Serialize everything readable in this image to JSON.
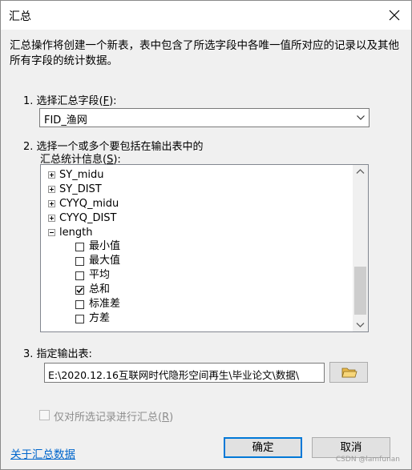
{
  "window": {
    "title": "汇总"
  },
  "description": "汇总操作将创建一个新表，表中包含了所选字段中各唯一值所对应的记录以及其他所有字段的统计数据。",
  "step1": {
    "label_prefix": "1. 选择汇总字段(",
    "label_key": "F",
    "label_suffix": "):",
    "value": "FID_渔网"
  },
  "step2": {
    "label_line1": "2. 选择一个或多个要包括在输出表中的",
    "label_line2_prefix": "汇总统计信息(",
    "label_line2_key": "S",
    "label_line2_suffix": "):",
    "tree": [
      {
        "label": "SY_midu",
        "expander": "plus"
      },
      {
        "label": "SY_DIST",
        "expander": "plus"
      },
      {
        "label": "CYYQ_midu",
        "expander": "plus"
      },
      {
        "label": "CYYQ_DIST",
        "expander": "plus"
      },
      {
        "label": "length",
        "expander": "minus"
      }
    ],
    "stats": [
      {
        "label": "最小值",
        "checked": false
      },
      {
        "label": "最大值",
        "checked": false
      },
      {
        "label": "平均",
        "checked": false
      },
      {
        "label": "总和",
        "checked": true
      },
      {
        "label": "标准差",
        "checked": false
      },
      {
        "label": "方差",
        "checked": false
      }
    ]
  },
  "step3": {
    "label": "3. 指定输出表:",
    "path": "E:\\2020.12.16互联网时代隐形空间再生\\毕业论文\\数据\\"
  },
  "selected_only": {
    "label_prefix": "仅对所选记录进行汇总(",
    "label_key": "R",
    "label_suffix": ")",
    "checked": false,
    "enabled": false
  },
  "footer": {
    "link": "关于汇总数据",
    "ok": "确定",
    "cancel": "取消"
  },
  "watermark": "CSDN @lamfunan",
  "colors": {
    "dialog_bg": "#f0f0f0",
    "link": "#0066cc",
    "focus_border": "#0078d7"
  }
}
